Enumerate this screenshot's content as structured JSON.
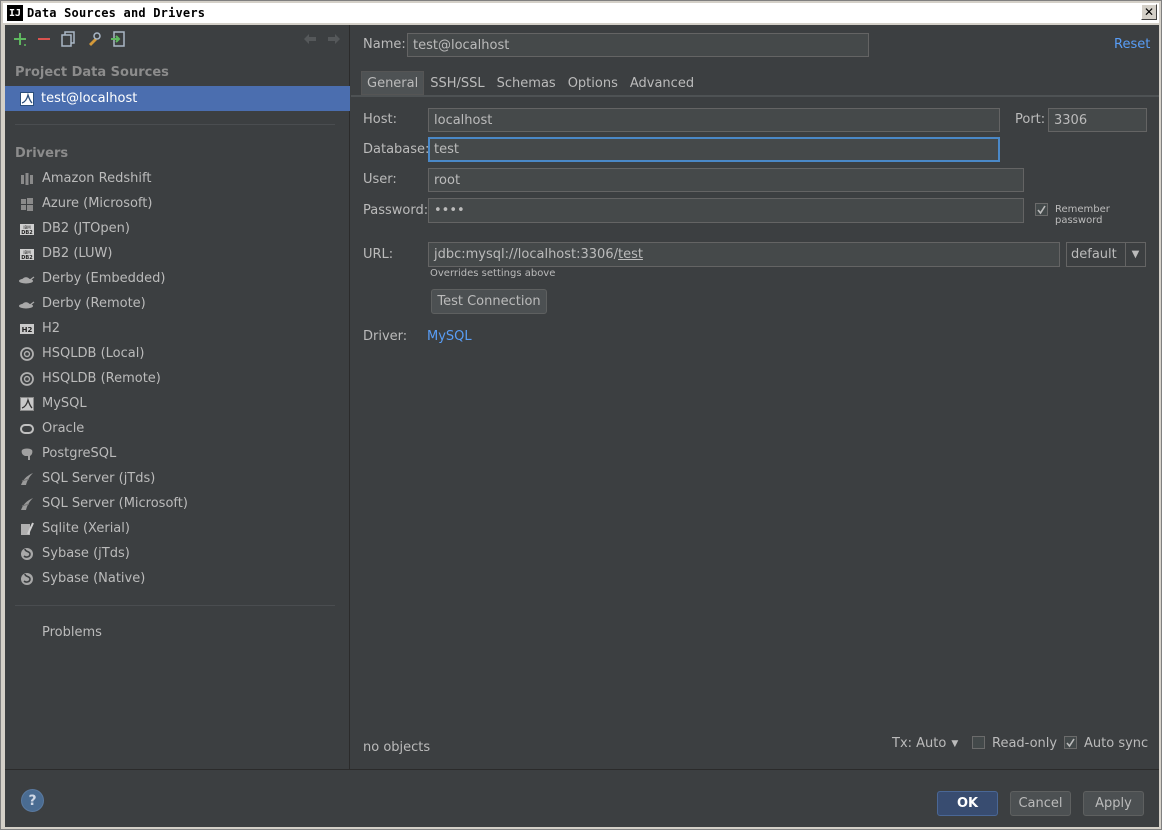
{
  "window": {
    "title": "Data Sources and Drivers",
    "app_icon": "IJ"
  },
  "toolbar": {
    "icons": [
      "add-icon",
      "remove-icon",
      "copy-icon",
      "settings-icon",
      "import-icon",
      "back-icon",
      "forward-icon"
    ]
  },
  "left": {
    "project_title": "Project Data Sources",
    "selected_source": "test@localhost",
    "drivers_title": "Drivers",
    "drivers": [
      {
        "label": "Amazon Redshift",
        "icon": "redshift-icon"
      },
      {
        "label": "Azure (Microsoft)",
        "icon": "azure-icon"
      },
      {
        "label": "DB2 (JTOpen)",
        "icon": "db2-icon"
      },
      {
        "label": "DB2 (LUW)",
        "icon": "db2-icon"
      },
      {
        "label": "Derby (Embedded)",
        "icon": "derby-icon"
      },
      {
        "label": "Derby (Remote)",
        "icon": "derby-icon"
      },
      {
        "label": "H2",
        "icon": "h2-icon"
      },
      {
        "label": "HSQLDB (Local)",
        "icon": "hsqldb-icon"
      },
      {
        "label": "HSQLDB (Remote)",
        "icon": "hsqldb-icon"
      },
      {
        "label": "MySQL",
        "icon": "mysql-icon"
      },
      {
        "label": "Oracle",
        "icon": "oracle-icon"
      },
      {
        "label": "PostgreSQL",
        "icon": "postgresql-icon"
      },
      {
        "label": "SQL Server (jTds)",
        "icon": "sqlserver-icon"
      },
      {
        "label": "SQL Server (Microsoft)",
        "icon": "sqlserver-icon"
      },
      {
        "label": "Sqlite (Xerial)",
        "icon": "sqlite-icon"
      },
      {
        "label": "Sybase (jTds)",
        "icon": "sybase-icon"
      },
      {
        "label": "Sybase (Native)",
        "icon": "sybase-icon"
      }
    ],
    "problems": "Problems"
  },
  "form": {
    "name_label": "Name:",
    "name_value": "test@localhost",
    "reset": "Reset",
    "tabs": [
      "General",
      "SSH/SSL",
      "Schemas",
      "Options",
      "Advanced"
    ],
    "host_label": "Host:",
    "host_value": "localhost",
    "port_label": "Port:",
    "port_value": "3306",
    "database_label": "Database:",
    "database_value": "test",
    "user_label": "User:",
    "user_value": "root",
    "password_label": "Password:",
    "password_value": "••••",
    "remember_password": "Remember password",
    "url_label": "URL:",
    "url_prefix": "jdbc:mysql://localhost:3306/",
    "url_db": "test",
    "url_mode": "default",
    "overrides_note": "Overrides settings above",
    "test_connection": "Test Connection",
    "driver_label": "Driver:",
    "driver_value": "MySQL",
    "status": "no objects",
    "tx": "Tx: Auto",
    "read_only": "Read-only",
    "auto_sync": "Auto sync"
  },
  "buttons": {
    "ok": "OK",
    "cancel": "Cancel",
    "apply": "Apply",
    "help": "?"
  }
}
